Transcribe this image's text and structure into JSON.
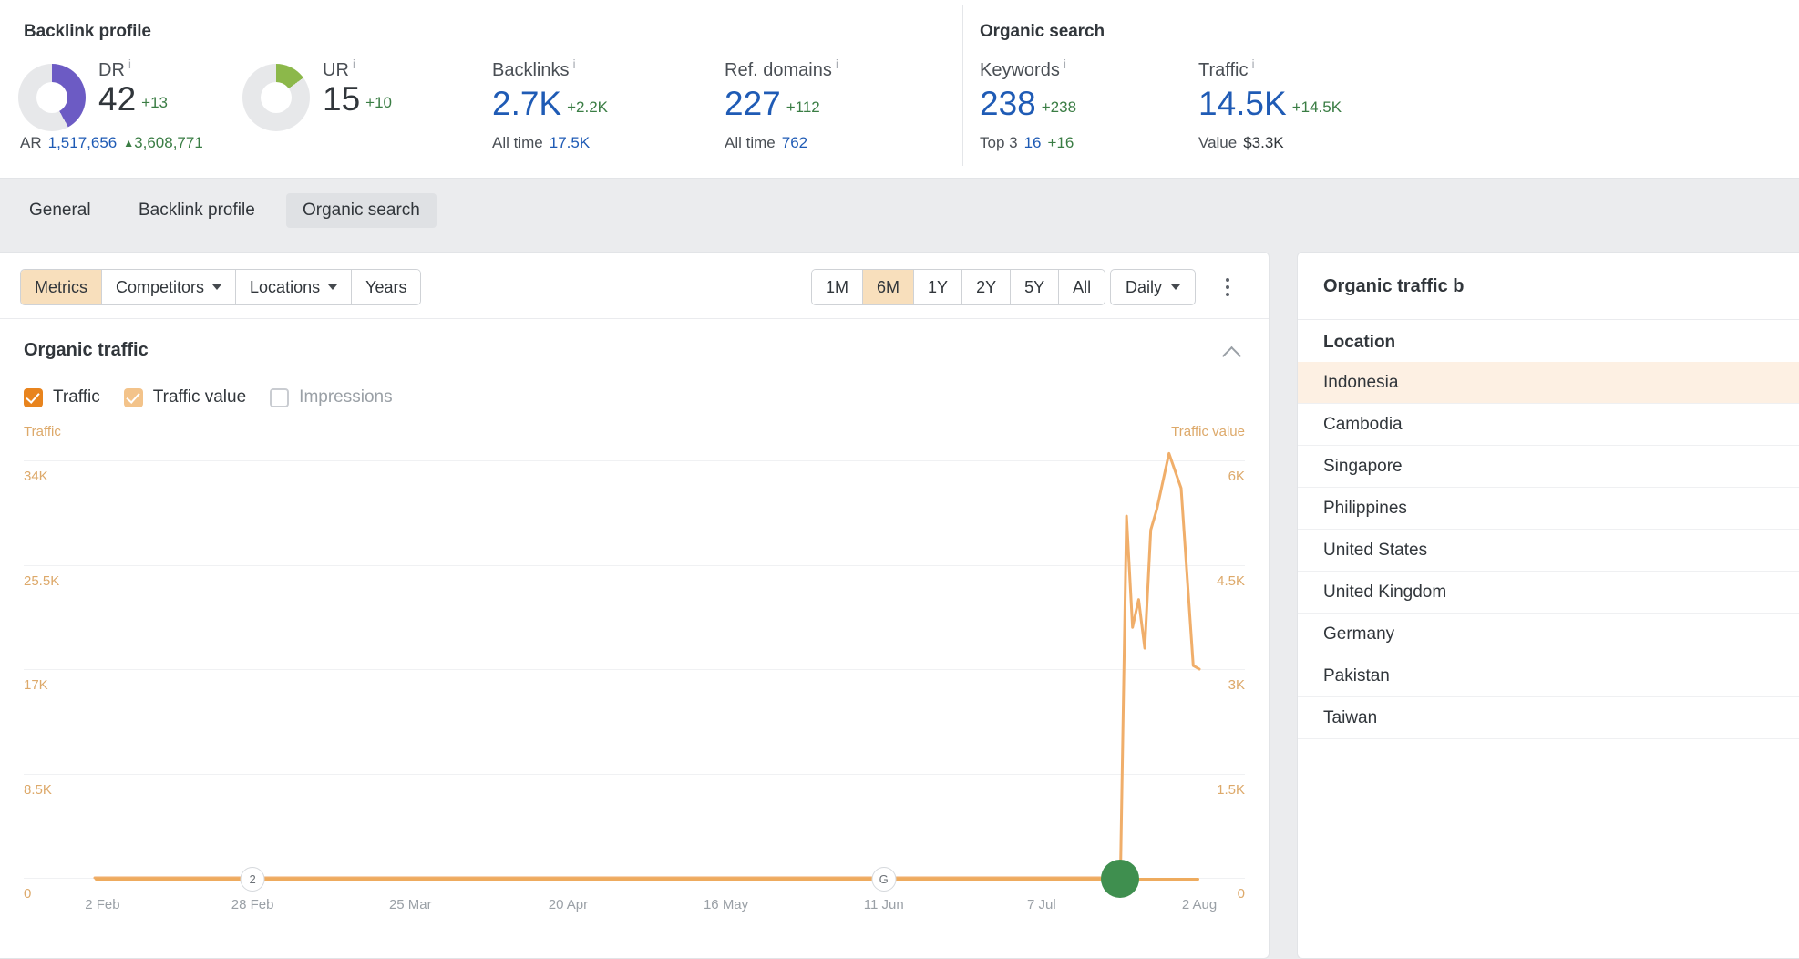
{
  "summary": {
    "backlink_profile": {
      "title": "Backlink profile",
      "dr": {
        "label": "DR",
        "value": "42",
        "delta": "+13",
        "pct": 42,
        "color": "#6c5bc4"
      },
      "ur": {
        "label": "UR",
        "value": "15",
        "delta": "+10",
        "pct": 15,
        "color": "#8cb84a"
      },
      "backlinks": {
        "label": "Backlinks",
        "value": "2.7K",
        "delta": "+2.2K",
        "sub_label": "All time",
        "sub_value": "17.5K"
      },
      "ref_domains": {
        "label": "Ref. domains",
        "value": "227",
        "delta": "+112",
        "sub_label": "All time",
        "sub_value": "762"
      },
      "ar": {
        "label": "AR",
        "value": "1,517,656",
        "delta": "3,608,771"
      }
    },
    "organic_search": {
      "title": "Organic search",
      "keywords": {
        "label": "Keywords",
        "value": "238",
        "delta": "+238",
        "sub_label": "Top 3",
        "sub_value": "16",
        "sub_delta": "+16"
      },
      "traffic": {
        "label": "Traffic",
        "value": "14.5K",
        "delta": "+14.5K",
        "sub_label": "Value",
        "sub_value": "$3.3K"
      }
    }
  },
  "tabs": [
    {
      "label": "General",
      "active": false
    },
    {
      "label": "Backlink profile",
      "active": false
    },
    {
      "label": "Organic search",
      "active": true
    }
  ],
  "toolbar": {
    "left_group": [
      {
        "label": "Metrics",
        "active": true,
        "caret": false
      },
      {
        "label": "Competitors",
        "active": false,
        "caret": true
      },
      {
        "label": "Locations",
        "active": false,
        "caret": true
      },
      {
        "label": "Years",
        "active": false,
        "caret": false
      }
    ],
    "ranges": [
      {
        "label": "1M",
        "active": false
      },
      {
        "label": "6M",
        "active": true
      },
      {
        "label": "1Y",
        "active": false
      },
      {
        "label": "2Y",
        "active": false
      },
      {
        "label": "5Y",
        "active": false
      },
      {
        "label": "All",
        "active": false
      }
    ],
    "granularity": "Daily",
    "more_menu": "more-options"
  },
  "chart_panel": {
    "title": "Organic traffic",
    "legend": [
      {
        "label": "Traffic",
        "state": "checked-strong"
      },
      {
        "label": "Traffic value",
        "state": "checked-light"
      },
      {
        "label": "Impressions",
        "state": "unchecked"
      }
    ]
  },
  "side_panel": {
    "title": "Organic traffic b",
    "column_header": "Location",
    "locations": [
      {
        "name": "Indonesia",
        "highlight": true
      },
      {
        "name": "Cambodia",
        "highlight": false
      },
      {
        "name": "Singapore",
        "highlight": false
      },
      {
        "name": "Philippines",
        "highlight": false
      },
      {
        "name": "United States",
        "highlight": false
      },
      {
        "name": "United Kingdom",
        "highlight": false
      },
      {
        "name": "Germany",
        "highlight": false
      },
      {
        "name": "Pakistan",
        "highlight": false
      },
      {
        "name": "Taiwan",
        "highlight": false
      }
    ]
  },
  "chart_data": {
    "type": "line",
    "title": "Organic traffic",
    "xlabel": "",
    "grid": true,
    "legend_position": "top-left",
    "x_ticks": [
      "2 Feb",
      "28 Feb",
      "25 Mar",
      "20 Apr",
      "16 May",
      "11 Jun",
      "7 Jul",
      "2 Aug"
    ],
    "axes": {
      "left": {
        "name": "Traffic",
        "ticks": [
          "34K",
          "25.5K",
          "17K",
          "8.5K",
          "0"
        ],
        "ylim": [
          0,
          34000
        ],
        "color": "#e8841e"
      },
      "right": {
        "name": "Traffic value",
        "ticks": [
          "6K",
          "4.5K",
          "3K",
          "1.5K",
          "0"
        ],
        "ylim": [
          0,
          6000
        ],
        "color": "#f3c38a"
      }
    },
    "series": [
      {
        "name": "Traffic",
        "axis": "left",
        "color": "#e8841e",
        "points": [
          {
            "x": "2 Feb",
            "y": 0
          },
          {
            "x": "28 Feb",
            "y": 0
          },
          {
            "x": "25 Mar",
            "y": 0
          },
          {
            "x": "20 Apr",
            "y": 0
          },
          {
            "x": "16 May",
            "y": 0
          },
          {
            "x": "11 Jun",
            "y": 0
          },
          {
            "x": "7 Jul",
            "y": 0
          },
          {
            "x": "26 Jul",
            "y": 0
          },
          {
            "x": "2 Aug",
            "y": 0
          }
        ]
      },
      {
        "name": "Traffic value",
        "axis": "right",
        "color": "#f0ae6a",
        "points": [
          {
            "x": "2 Feb",
            "y": 0
          },
          {
            "x": "11 Jun",
            "y": 0
          },
          {
            "x": "20 Jul",
            "y": 0
          },
          {
            "x": "21 Jul",
            "y": 5200
          },
          {
            "x": "22 Jul",
            "y": 3600
          },
          {
            "x": "23 Jul",
            "y": 4000
          },
          {
            "x": "24 Jul",
            "y": 3300
          },
          {
            "x": "25 Jul",
            "y": 5000
          },
          {
            "x": "26 Jul",
            "y": 5300
          },
          {
            "x": "28 Jul",
            "y": 6100
          },
          {
            "x": "30 Jul",
            "y": 5600
          },
          {
            "x": "1 Aug",
            "y": 3050
          },
          {
            "x": "2 Aug",
            "y": 3000
          }
        ]
      }
    ],
    "annotations": [
      {
        "label": "2",
        "x": "28 Feb",
        "type": "event-marker"
      },
      {
        "label": "G",
        "x": "11 Jun",
        "type": "google-update-marker"
      },
      {
        "label": "",
        "x": "20 Jul",
        "type": "highlight-dot",
        "color": "#3f8f4f"
      }
    ]
  }
}
